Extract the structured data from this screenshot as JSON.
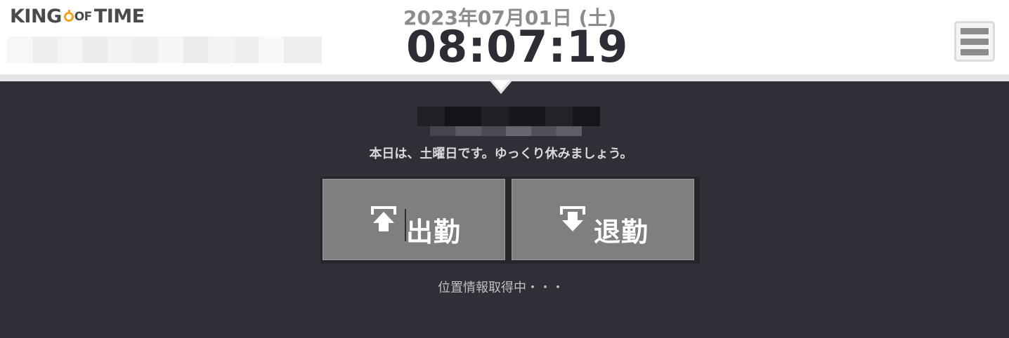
{
  "header": {
    "logo": {
      "part1": "KING",
      "part2": "OF",
      "part3": "TIME"
    },
    "date": "2023年07月01日 (土)",
    "time": "08:07:19",
    "menu_icon": "hamburger-menu-icon"
  },
  "main": {
    "message": "本日は、土曜日です。ゆっくり休みましょう。",
    "buttons": {
      "clock_in": {
        "label": "出勤",
        "icon": "clock-in-arrow-up-icon"
      },
      "clock_out": {
        "label": "退勤",
        "icon": "clock-out-arrow-down-icon"
      }
    },
    "location_status": "位置情報取得中・・・"
  },
  "colors": {
    "background": "#2f2f38",
    "header": "#ffffff",
    "button": "#7f7f7f",
    "logo_accent": "#f0a41c"
  }
}
